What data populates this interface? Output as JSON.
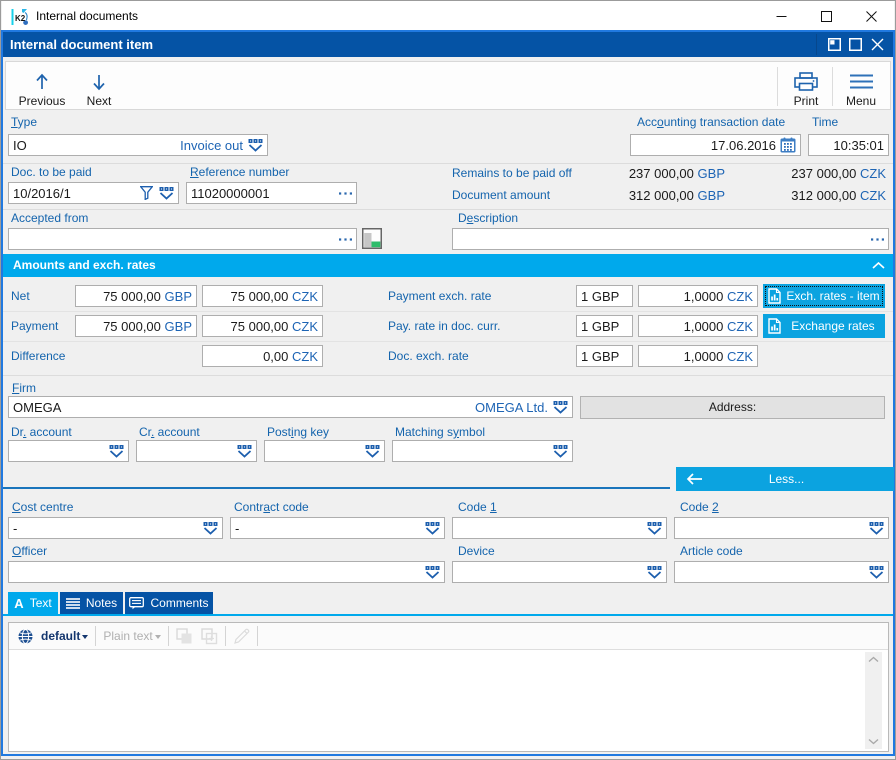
{
  "window": {
    "title": "Internal documents",
    "app_logo_text": "K2"
  },
  "doc_window": {
    "title": "Internal document item"
  },
  "toolbar": {
    "previous": "Previous",
    "next": "Next",
    "print": "Print",
    "menu": "Menu"
  },
  "labels": {
    "type": {
      "text": "Type",
      "accel": 0
    },
    "acc_date": {
      "text": "Accounting transaction date",
      "accel": 3
    },
    "time": {
      "text": "Time",
      "accel": -1
    },
    "doc_to_be_paid": {
      "text": "Doc. to be paid",
      "accel": -1
    },
    "reference_number": {
      "text": "Reference number",
      "accel": 0
    },
    "remains": {
      "text": "Remains to be paid off",
      "accel": -1
    },
    "document_amount": {
      "text": "Document amount",
      "accel": -1
    },
    "accepted_from": {
      "text": "Accepted from",
      "accel": -1
    },
    "description": {
      "text": "Description",
      "accel": 1
    },
    "firm": {
      "text": "Firm",
      "accel": 0
    },
    "dr_account": {
      "text": "Dr. account",
      "accel": 2
    },
    "cr_account": {
      "text": "Cr. account",
      "accel": 2
    },
    "posting_key": {
      "text": "Posting key",
      "accel": 4
    },
    "matching_symbol": {
      "text": "Matching symbol",
      "accel": 10
    },
    "cost_centre": {
      "text": "Cost centre",
      "accel": 0
    },
    "contract_code": {
      "text": "Contract code",
      "accel": 5
    },
    "code1": {
      "text": "Code 1",
      "accel": 5
    },
    "code2": {
      "text": "Code 2",
      "accel": 5
    },
    "officer": {
      "text": "Officer",
      "accel": 0
    },
    "device": {
      "text": "Device",
      "accel": -1
    },
    "article_code": {
      "text": "Article code",
      "accel": -1
    }
  },
  "fields": {
    "type_code": "IO",
    "type_name": "Invoice out",
    "acc_date": "17.06.2016",
    "time": "10:35:01",
    "doc_to_be_paid": "10/2016/1",
    "reference_number": "11020000001",
    "remains_gbp": "237 000,00",
    "remains_gbp_cur": "GBP",
    "remains_czk": "237 000,00",
    "remains_czk_cur": "CZK",
    "amount_gbp": "312 000,00",
    "amount_gbp_cur": "GBP",
    "amount_czk": "312 000,00",
    "amount_czk_cur": "CZK",
    "accepted_from": "",
    "description": "",
    "firm_code": "OMEGA",
    "firm_name": "OMEGA Ltd.",
    "address_button": "Address:",
    "dr_account": "",
    "cr_account": "",
    "posting_key": "",
    "matching_symbol": ""
  },
  "amounts_section": {
    "title": "Amounts and exch. rates",
    "rows": [
      {
        "label": "Net",
        "gbp": "75 000,00",
        "gbp_cur": "GBP",
        "czk": "75 000,00",
        "czk_cur": "CZK",
        "rate_label": "Payment exch. rate",
        "unit": "1 GBP",
        "rate": "1,0000",
        "rate_cur": "CZK",
        "button": "Exch. rates - item"
      },
      {
        "label": "Payment",
        "gbp": "75 000,00",
        "gbp_cur": "GBP",
        "czk": "75 000,00",
        "czk_cur": "CZK",
        "rate_label": "Pay. rate in doc. curr.",
        "unit": "1 GBP",
        "rate": "1,0000",
        "rate_cur": "CZK",
        "button": "Exchange rates"
      },
      {
        "label": "Difference",
        "czk": "0,00",
        "czk_cur": "CZK",
        "rate_label": "Doc. exch. rate",
        "unit": "1 GBP",
        "rate": "1,0000",
        "rate_cur": "CZK"
      }
    ]
  },
  "less_button": "Less...",
  "codes": {
    "cost_centre": "-",
    "contract_code": "-",
    "code1": "",
    "code2": "",
    "officer": "",
    "device": "",
    "article_code": ""
  },
  "tabs": [
    {
      "label": "Text",
      "active": true
    },
    {
      "label": "Notes",
      "active": false
    },
    {
      "label": "Comments",
      "active": false
    }
  ],
  "editor": {
    "language": "default",
    "format": "Plain text",
    "content": ""
  }
}
